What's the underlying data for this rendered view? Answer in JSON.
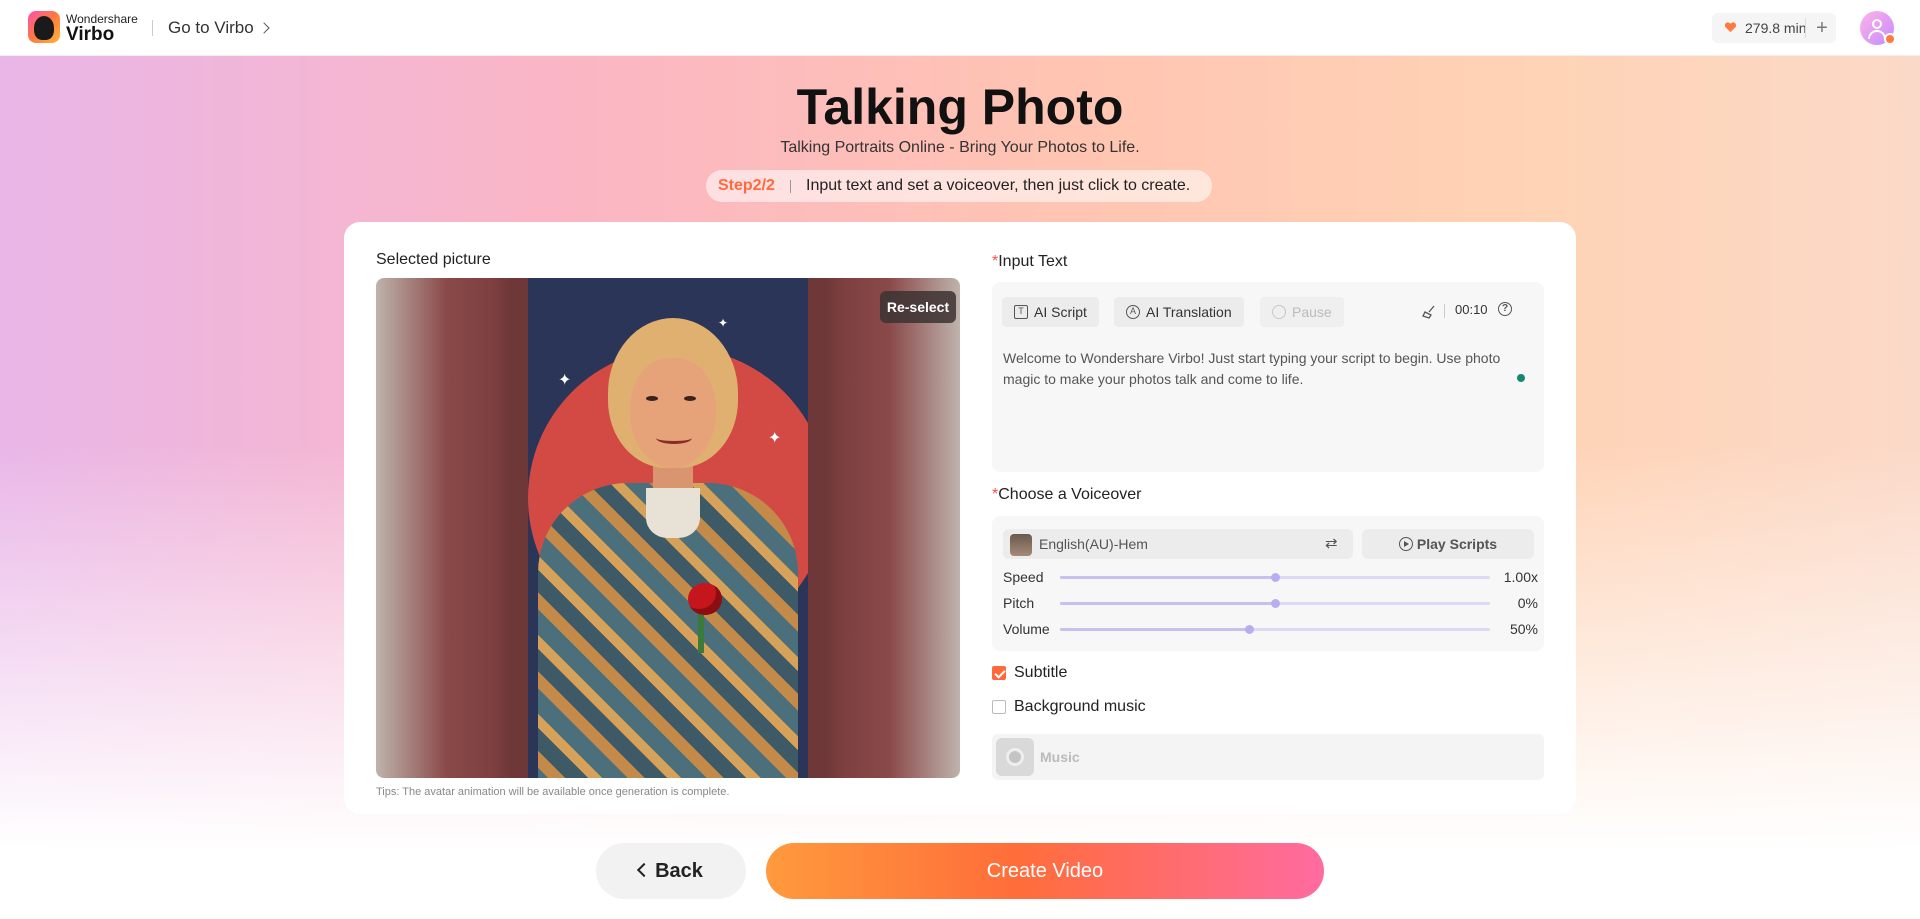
{
  "header": {
    "brand_small": "Wondershare",
    "brand_big": "Virbo",
    "goto_label": "Go to Virbo",
    "credits": "279.8 min",
    "plus": "+"
  },
  "hero": {
    "title": "Talking Photo",
    "subtitle": "Talking Portraits Online - Bring Your Photos to Life.",
    "step": "Step2/2",
    "step_text": "Input text and set a voiceover, then just click to create."
  },
  "picture": {
    "label": "Selected picture",
    "reselect": "Re-select",
    "tips": "Tips: The avatar animation will be available once generation is complete."
  },
  "input_text": {
    "label": "Input Text",
    "required_mark": "*",
    "buttons": [
      {
        "label": "AI Script",
        "icon": "T"
      },
      {
        "label": "AI Translation",
        "icon": "A"
      },
      {
        "label": "Pause",
        "icon": ""
      }
    ],
    "duration": "00:10",
    "help": "?",
    "script": "Welcome to Wondershare Virbo! Just start typing your script to begin. Use photo magic to make your photos talk and come to life."
  },
  "voiceover": {
    "label": "Choose a Voiceover",
    "required_mark": "*",
    "voice_name": "English(AU)-Hem",
    "swap_glyph": "⇄",
    "play_label": "Play Scripts",
    "sliders": [
      {
        "label": "Speed",
        "value_text": "1.00x",
        "level": 0.5
      },
      {
        "label": "Pitch",
        "value_text": "0%",
        "level": 0.5
      },
      {
        "label": "Volume",
        "value_text": "50%",
        "level": 0.44
      }
    ]
  },
  "options": {
    "subtitle_label": "Subtitle",
    "subtitle_checked": true,
    "bgm_label": "Background music",
    "bgm_checked": false,
    "music_label": "Music"
  },
  "actions": {
    "back": "Back",
    "create": "Create Video"
  },
  "colors": {
    "accent": "#ff6a3d",
    "required": "#ff4d4f",
    "slider": "#b7aef0"
  }
}
